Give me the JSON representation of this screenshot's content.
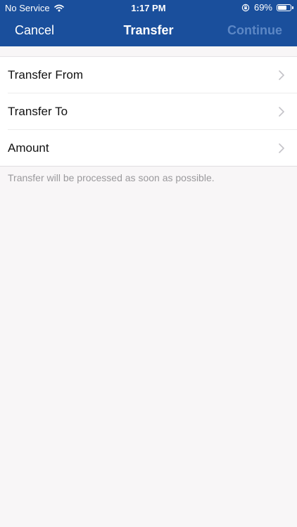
{
  "status_bar": {
    "carrier": "No Service",
    "time": "1:17 PM",
    "battery_percent": "69%",
    "battery_level": 0.69,
    "icons": [
      "wifi-icon",
      "orientation-lock-icon",
      "battery-icon"
    ]
  },
  "nav": {
    "cancel_label": "Cancel",
    "title": "Transfer",
    "continue_label": "Continue"
  },
  "form": {
    "rows": [
      {
        "label": "Transfer From",
        "icon": "chevron-right-icon"
      },
      {
        "label": "Transfer To",
        "icon": "chevron-right-icon"
      },
      {
        "label": "Amount",
        "icon": "chevron-right-icon"
      }
    ]
  },
  "footer_note": "Transfer will be processed as soon as possible.",
  "colors": {
    "nav_background": "#1a4f9c",
    "continue_disabled": "#5c87c5",
    "page_background": "#f8f6f7",
    "note_text": "#9a999c"
  }
}
